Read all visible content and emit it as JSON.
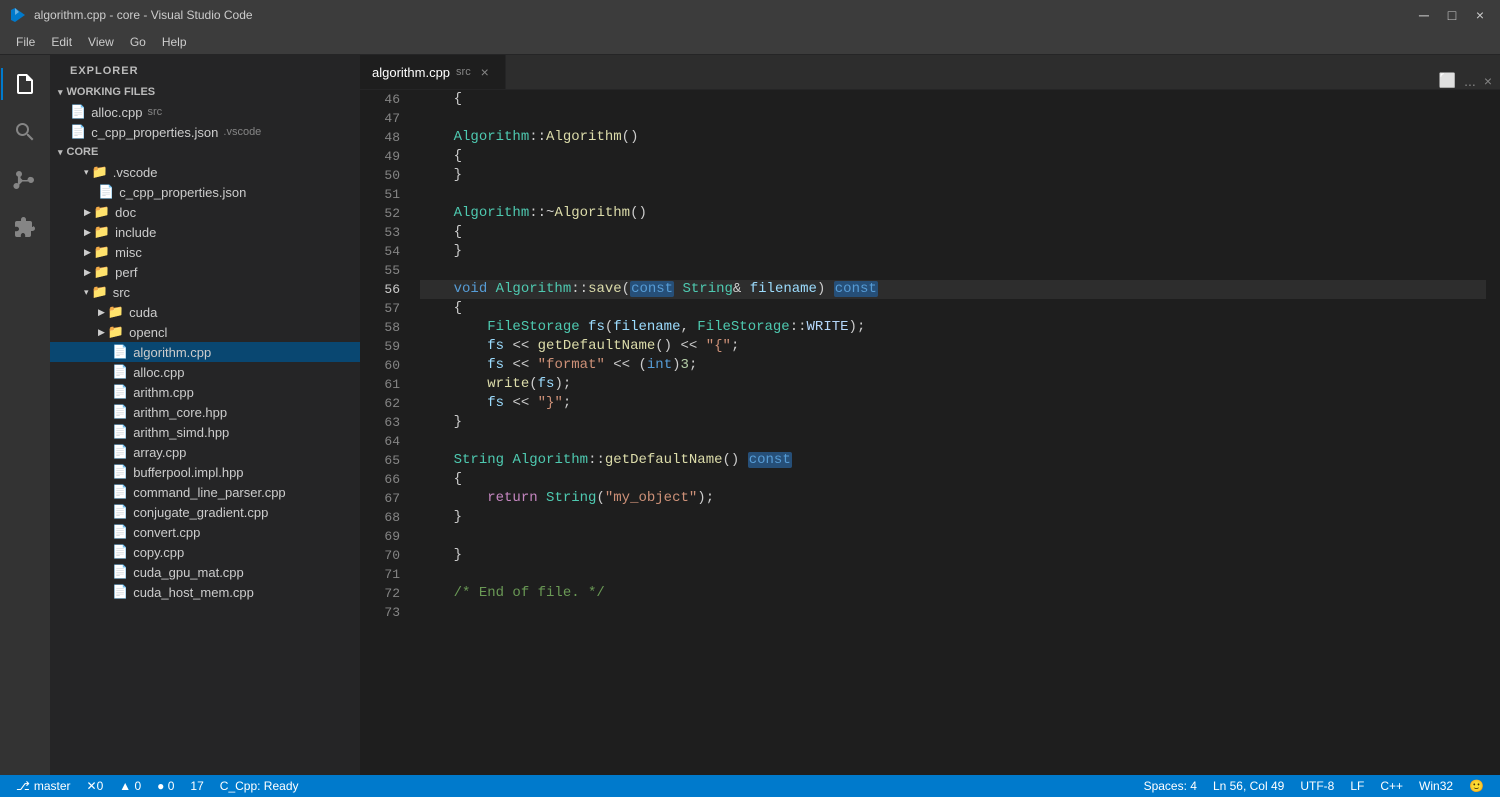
{
  "titlebar": {
    "title": "algorithm.cpp - core - Visual Studio Code",
    "icon": "●",
    "minimize": "─",
    "maximize": "□",
    "close": "×"
  },
  "menubar": {
    "items": [
      "File",
      "Edit",
      "View",
      "Go",
      "Help"
    ]
  },
  "sidebar": {
    "header": "Explorer",
    "working_files": {
      "label": "WORKING FILES",
      "files": [
        {
          "name": "alloc.cpp",
          "badge": "src"
        },
        {
          "name": "c_cpp_properties.json",
          "badge": ".vscode"
        }
      ]
    },
    "core": {
      "label": "CORE",
      "items": [
        {
          "name": ".vscode",
          "type": "folder",
          "indent": 1
        },
        {
          "name": "c_cpp_properties.json",
          "type": "file",
          "indent": 2
        },
        {
          "name": "doc",
          "type": "folder",
          "indent": 1
        },
        {
          "name": "include",
          "type": "folder",
          "indent": 1
        },
        {
          "name": "misc",
          "type": "folder",
          "indent": 1
        },
        {
          "name": "perf",
          "type": "folder",
          "indent": 1
        },
        {
          "name": "src",
          "type": "folder",
          "indent": 1,
          "expanded": true
        },
        {
          "name": "cuda",
          "type": "folder",
          "indent": 2
        },
        {
          "name": "opencl",
          "type": "folder",
          "indent": 2
        },
        {
          "name": "algorithm.cpp",
          "type": "file",
          "indent": 3,
          "active": true
        },
        {
          "name": "alloc.cpp",
          "type": "file",
          "indent": 3
        },
        {
          "name": "arithm.cpp",
          "type": "file",
          "indent": 3
        },
        {
          "name": "arithm_core.hpp",
          "type": "file",
          "indent": 3
        },
        {
          "name": "arithm_simd.hpp",
          "type": "file",
          "indent": 3
        },
        {
          "name": "array.cpp",
          "type": "file",
          "indent": 3
        },
        {
          "name": "bufferpool.impl.hpp",
          "type": "file",
          "indent": 3
        },
        {
          "name": "command_line_parser.cpp",
          "type": "file",
          "indent": 3
        },
        {
          "name": "conjugate_gradient.cpp",
          "type": "file",
          "indent": 3
        },
        {
          "name": "convert.cpp",
          "type": "file",
          "indent": 3
        },
        {
          "name": "copy.cpp",
          "type": "file",
          "indent": 3
        },
        {
          "name": "cuda_gpu_mat.cpp",
          "type": "file",
          "indent": 3
        },
        {
          "name": "cuda_host_mem.cpp",
          "type": "file",
          "indent": 3
        }
      ]
    }
  },
  "tab": {
    "filename": "algorithm.cpp",
    "path": "src"
  },
  "code": {
    "lines": [
      {
        "num": 46,
        "content": "    {"
      },
      {
        "num": 47,
        "content": ""
      },
      {
        "num": 48,
        "content": "    Algorithm::Algorithm()"
      },
      {
        "num": 49,
        "content": "    {"
      },
      {
        "num": 50,
        "content": "    }"
      },
      {
        "num": 51,
        "content": ""
      },
      {
        "num": 52,
        "content": "    Algorithm::~Algorithm()"
      },
      {
        "num": 53,
        "content": "    {"
      },
      {
        "num": 54,
        "content": "    }"
      },
      {
        "num": 55,
        "content": ""
      },
      {
        "num": 56,
        "content": "    void Algorithm::save(const String& filename) const",
        "highlight": true
      },
      {
        "num": 57,
        "content": "    {"
      },
      {
        "num": 58,
        "content": "        FileStorage fs(filename, FileStorage::WRITE);"
      },
      {
        "num": 59,
        "content": "        fs << getDefaultName() << \"{\";"
      },
      {
        "num": 60,
        "content": "        fs << \"format\" << (int)3;"
      },
      {
        "num": 61,
        "content": "        write(fs);"
      },
      {
        "num": 62,
        "content": "        fs << \"}\";"
      },
      {
        "num": 63,
        "content": "    }"
      },
      {
        "num": 64,
        "content": ""
      },
      {
        "num": 65,
        "content": "    String Algorithm::getDefaultName() const",
        "highlight2": true
      },
      {
        "num": 66,
        "content": "    {"
      },
      {
        "num": 67,
        "content": "        return String(\"my_object\");"
      },
      {
        "num": 68,
        "content": "    }"
      },
      {
        "num": 69,
        "content": ""
      },
      {
        "num": 70,
        "content": "    }"
      },
      {
        "num": 71,
        "content": ""
      },
      {
        "num": 72,
        "content": "    /* End of file. */"
      },
      {
        "num": 73,
        "content": ""
      }
    ]
  },
  "statusbar": {
    "errors": "0",
    "warnings": "▲ 0",
    "info": "● 0",
    "count": "17",
    "language": "C_Cpp: Ready",
    "spaces": "Spaces: 4",
    "position": "Ln 56, Col 49",
    "encoding": "UTF-8",
    "line_ending": "LF",
    "lang": "C++",
    "platform": "Win32",
    "smiley": "🙂"
  }
}
